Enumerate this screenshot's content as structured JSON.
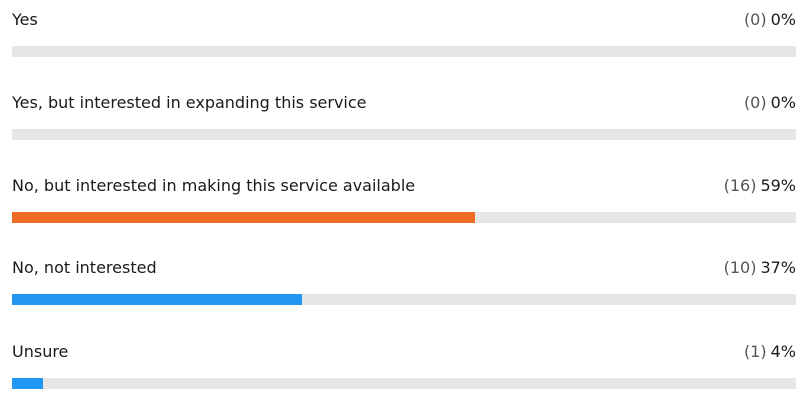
{
  "chart_data": {
    "type": "bar",
    "orientation": "horizontal",
    "xlim": [
      0,
      100
    ],
    "items": [
      {
        "label": "Yes",
        "count_text": "(0)",
        "percent_text": "0%",
        "count": 0,
        "percent": 0,
        "color": "#e6e6e6"
      },
      {
        "label": "Yes, but interested in expanding this service",
        "count_text": "(0)",
        "percent_text": "0%",
        "count": 0,
        "percent": 0,
        "color": "#e6e6e6"
      },
      {
        "label": "No, but interested in making this service available",
        "count_text": "(16)",
        "percent_text": "59%",
        "count": 16,
        "percent": 59,
        "color": "#ef6c24"
      },
      {
        "label": "No, not interested",
        "count_text": "(10)",
        "percent_text": "37%",
        "count": 10,
        "percent": 37,
        "color": "#2196f3"
      },
      {
        "label": "Unsure",
        "count_text": "(1)",
        "percent_text": "4%",
        "count": 1,
        "percent": 4,
        "color": "#2196f3"
      }
    ]
  },
  "colors": {
    "track": "#e6e6e6",
    "accent_orange": "#ef6c24",
    "accent_blue": "#2196f3"
  }
}
